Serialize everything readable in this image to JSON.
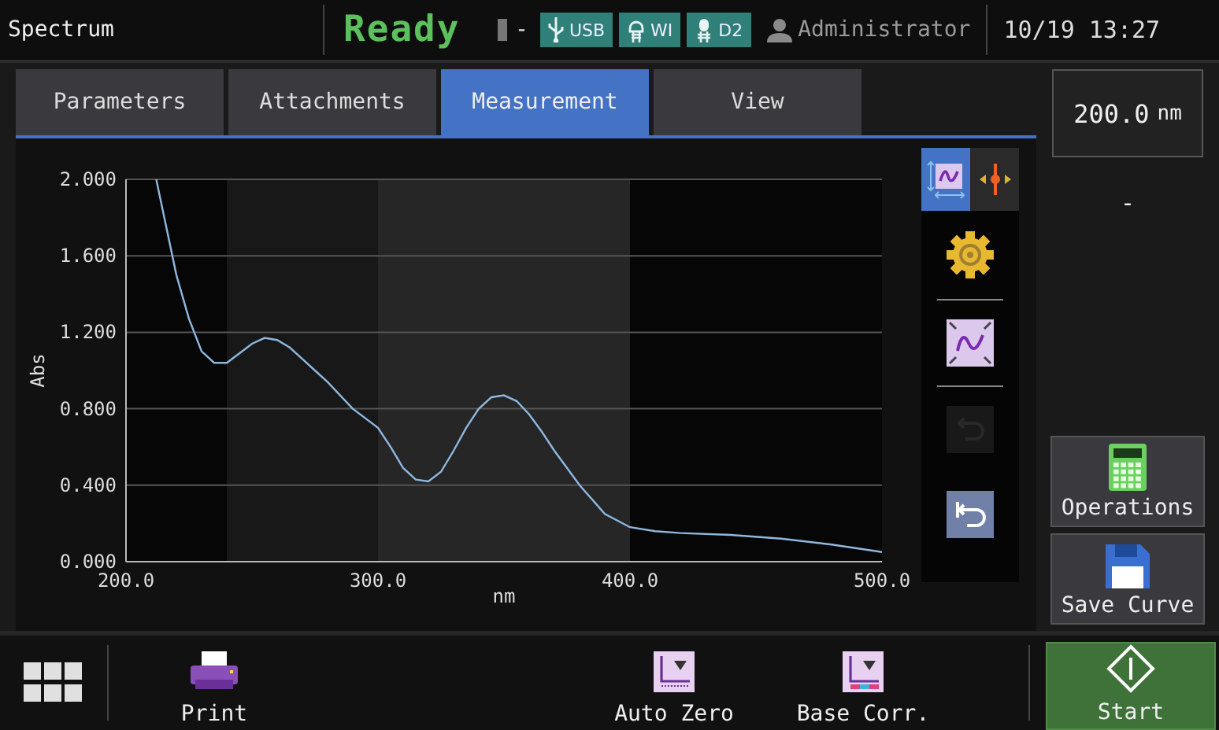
{
  "header": {
    "title": "Spectrum",
    "status": "Ready",
    "lamp_reading": "-",
    "chips": [
      {
        "kind": "usb",
        "label": "USB"
      },
      {
        "kind": "wi",
        "label": "WI"
      },
      {
        "kind": "d2",
        "label": "D2"
      }
    ],
    "user": "Administrator",
    "datetime": "10/19 13:27"
  },
  "tabs": [
    {
      "label": "Parameters",
      "selected": false
    },
    {
      "label": "Attachments",
      "selected": false
    },
    {
      "label": "Measurement",
      "selected": true
    },
    {
      "label": "View",
      "selected": false
    }
  ],
  "chart_data": {
    "type": "line",
    "xlabel": "nm",
    "ylabel": "Abs",
    "xlim": [
      200,
      500
    ],
    "ylim": [
      0,
      2
    ],
    "x": [
      212,
      216,
      220,
      225,
      230,
      235,
      240,
      245,
      250,
      255,
      260,
      265,
      270,
      275,
      280,
      290,
      300,
      305,
      310,
      315,
      320,
      325,
      330,
      335,
      340,
      345,
      350,
      355,
      360,
      365,
      370,
      380,
      390,
      400,
      410,
      420,
      440,
      460,
      480,
      500
    ],
    "grid": true,
    "series": [
      {
        "color": "#8fb8e0",
        "values": [
          2.0,
          1.75,
          1.5,
          1.27,
          1.1,
          1.04,
          1.04,
          1.09,
          1.14,
          1.17,
          1.16,
          1.12,
          1.06,
          1.0,
          0.94,
          0.8,
          0.7,
          0.6,
          0.49,
          0.43,
          0.42,
          0.47,
          0.58,
          0.7,
          0.8,
          0.86,
          0.87,
          0.84,
          0.77,
          0.68,
          0.58,
          0.4,
          0.25,
          0.18,
          0.16,
          0.15,
          0.14,
          0.12,
          0.09,
          0.05
        ]
      }
    ],
    "xticks": [
      {
        "value": 200,
        "label": "200.0"
      },
      {
        "value": 300,
        "label": "300.0"
      },
      {
        "value": 400,
        "label": "400.0"
      },
      {
        "value": 500,
        "label": "500.0"
      }
    ],
    "yticks": [
      {
        "value": 0,
        "label": "0.000"
      },
      {
        "value": 0.4,
        "label": "0.400"
      },
      {
        "value": 0.8,
        "label": "0.800"
      },
      {
        "value": 1.2,
        "label": "1.200"
      },
      {
        "value": 1.6,
        "label": "1.600"
      },
      {
        "value": 2,
        "label": "2.000"
      }
    ]
  },
  "tools": [
    {
      "kind": "scale",
      "selected": true
    },
    {
      "kind": "cursor",
      "selected": false
    },
    {
      "kind": "settings"
    },
    {
      "kind": "autoscale"
    },
    {
      "kind": "undo",
      "disabled": true
    },
    {
      "kind": "reset",
      "disabled": false
    }
  ],
  "wavelength": {
    "value": "200.0",
    "unit": "nm"
  },
  "reading": "-",
  "side_buttons": [
    {
      "kind": "operations",
      "label": "Operations"
    },
    {
      "kind": "save",
      "label": "Save Curve"
    }
  ],
  "bottom_buttons": [
    {
      "kind": "print",
      "label": "Print"
    },
    {
      "kind": "autozero",
      "label": "Auto Zero"
    },
    {
      "kind": "basecorr",
      "label": "Base Corr."
    }
  ],
  "start": {
    "label": "Start"
  }
}
